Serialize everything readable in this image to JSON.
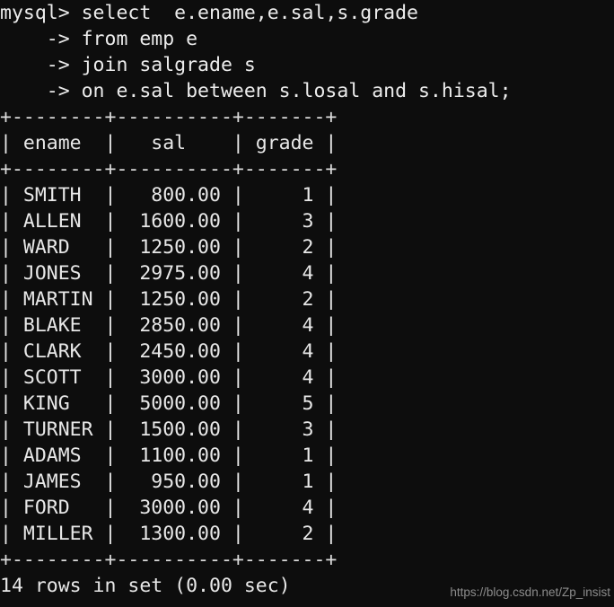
{
  "terminal": {
    "prompt": "mysql>",
    "continuation_prompt": "->",
    "background_color": "#0d0d0d",
    "text_color": "#e8e8e8",
    "watermark": "https://blog.csdn.net/Zp_insist",
    "query_lines": [
      "mysql> select  e.ename,e.sal,s.grade",
      "    -> from emp e",
      "    -> join salgrade s",
      "    -> on e.sal between s.losal and s.hisal;"
    ],
    "separator": "+--------+----------+-------+",
    "header_row": "| ename  |   sal    | grade |",
    "result": {
      "columns": [
        "ename",
        "sal",
        "grade"
      ],
      "rows": [
        {
          "ename": "SMITH",
          "sal": "800.00",
          "grade": "1",
          "line": "| SMITH  |   800.00 |     1 |"
        },
        {
          "ename": "ALLEN",
          "sal": "1600.00",
          "grade": "3",
          "line": "| ALLEN  |  1600.00 |     3 |"
        },
        {
          "ename": "WARD",
          "sal": "1250.00",
          "grade": "2",
          "line": "| WARD   |  1250.00 |     2 |"
        },
        {
          "ename": "JONES",
          "sal": "2975.00",
          "grade": "4",
          "line": "| JONES  |  2975.00 |     4 |"
        },
        {
          "ename": "MARTIN",
          "sal": "1250.00",
          "grade": "2",
          "line": "| MARTIN |  1250.00 |     2 |"
        },
        {
          "ename": "BLAKE",
          "sal": "2850.00",
          "grade": "4",
          "line": "| BLAKE  |  2850.00 |     4 |"
        },
        {
          "ename": "CLARK",
          "sal": "2450.00",
          "grade": "4",
          "line": "| CLARK  |  2450.00 |     4 |"
        },
        {
          "ename": "SCOTT",
          "sal": "3000.00",
          "grade": "4",
          "line": "| SCOTT  |  3000.00 |     4 |"
        },
        {
          "ename": "KING",
          "sal": "5000.00",
          "grade": "5",
          "line": "| KING   |  5000.00 |     5 |"
        },
        {
          "ename": "TURNER",
          "sal": "1500.00",
          "grade": "3",
          "line": "| TURNER |  1500.00 |     3 |"
        },
        {
          "ename": "ADAMS",
          "sal": "1100.00",
          "grade": "1",
          "line": "| ADAMS  |  1100.00 |     1 |"
        },
        {
          "ename": "JAMES",
          "sal": "950.00",
          "grade": "1",
          "line": "| JAMES  |   950.00 |     1 |"
        },
        {
          "ename": "FORD",
          "sal": "3000.00",
          "grade": "4",
          "line": "| FORD   |  3000.00 |     4 |"
        },
        {
          "ename": "MILLER",
          "sal": "1300.00",
          "grade": "2",
          "line": "| MILLER |  1300.00 |     2 |"
        }
      ],
      "row_count": 14,
      "status": "14 rows in set (0.00 sec)"
    }
  }
}
